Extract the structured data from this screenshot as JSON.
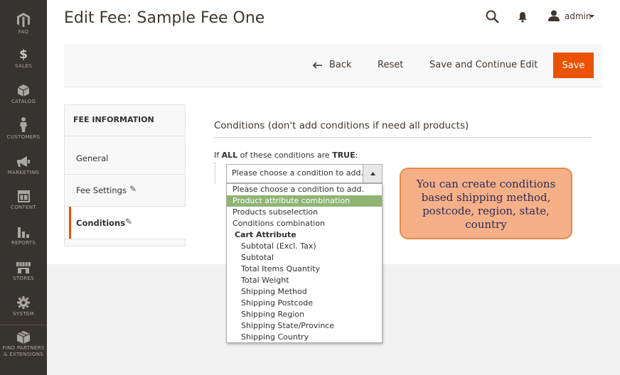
{
  "sidebar": {
    "items": [
      {
        "label": "FAQ",
        "icon": "magento-logo-icon"
      },
      {
        "label": "SALES",
        "icon": "dollar-icon"
      },
      {
        "label": "CATALOG",
        "icon": "cube-icon"
      },
      {
        "label": "CUSTOMERS",
        "icon": "person-icon"
      },
      {
        "label": "MARKETING",
        "icon": "megaphone-icon"
      },
      {
        "label": "CONTENT",
        "icon": "layout-icon"
      },
      {
        "label": "REPORTS",
        "icon": "bar-chart-icon"
      },
      {
        "label": "STORES",
        "icon": "storefront-icon"
      },
      {
        "label": "SYSTEM",
        "icon": "gear-icon"
      },
      {
        "label": "FIND PARTNERS & EXTENSIONS",
        "label_line1": "FIND PARTNERS",
        "label_line2": "& EXTENSIONS",
        "icon": "box-icon"
      }
    ]
  },
  "header": {
    "title": "Edit Fee: Sample Fee One",
    "user": "admin"
  },
  "actions": {
    "back": "Back",
    "reset": "Reset",
    "save_continue": "Save and Continue Edit",
    "save": "Save"
  },
  "tabs": {
    "title": "FEE INFORMATION",
    "items": [
      "General",
      "Fee Settings",
      "Conditions"
    ],
    "active": "Conditions"
  },
  "conditions": {
    "title": "Conditions (don't add conditions if need all products)",
    "rule_prefix": "If",
    "rule_all": "ALL",
    "rule_mid": "of these conditions are",
    "rule_true": "TRUE",
    "rule_suffix": ":",
    "select_value": "Please choose a condition to add.",
    "options": [
      {
        "label": "Please choose a condition to add.",
        "indent": 0
      },
      {
        "label": "Product attribute combination",
        "indent": 0,
        "selected": true
      },
      {
        "label": "Products subselection",
        "indent": 0
      },
      {
        "label": "Conditions combination",
        "indent": 0
      },
      {
        "label": "Cart Attribute",
        "indent": 1,
        "group": true
      },
      {
        "label": "Subtotal (Excl. Tax)",
        "indent": 2
      },
      {
        "label": "Subtotal",
        "indent": 2
      },
      {
        "label": "Total Items Quantity",
        "indent": 2
      },
      {
        "label": "Total Weight",
        "indent": 2
      },
      {
        "label": "Shipping Method",
        "indent": 2
      },
      {
        "label": "Shipping Postcode",
        "indent": 2
      },
      {
        "label": "Shipping Region",
        "indent": 2
      },
      {
        "label": "Shipping State/Province",
        "indent": 2
      },
      {
        "label": "Shipping Country",
        "indent": 2
      }
    ]
  },
  "callout": {
    "lines": [
      "You can create conditions",
      "based shipping method,",
      "postcode, region, state,",
      "country"
    ]
  },
  "colors": {
    "sidebar_bg": "#373330",
    "save_bg": "#eb5202",
    "selected_option": "#90b474",
    "callout_bg": "#f6b088"
  }
}
